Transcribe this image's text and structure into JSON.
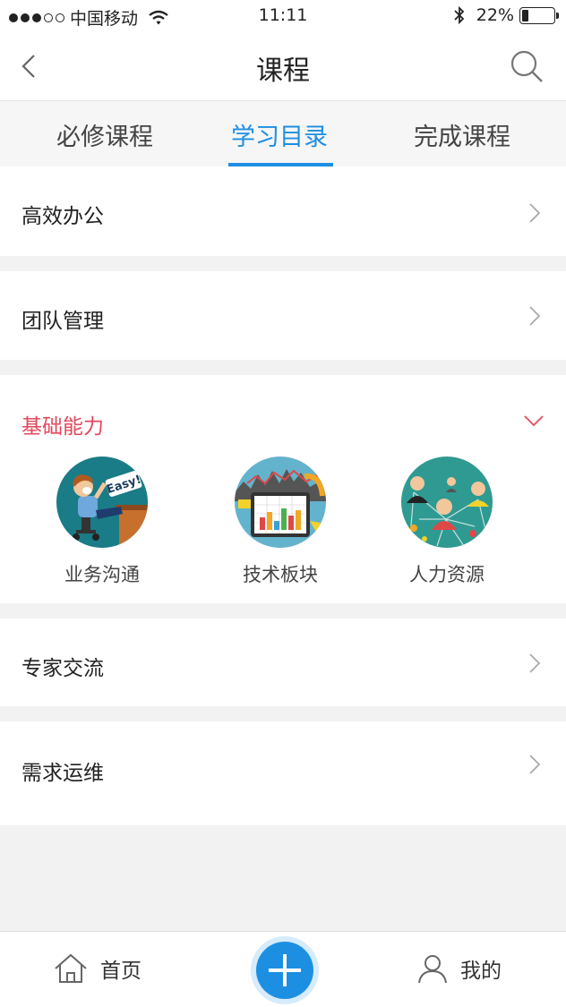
{
  "status_bar": {
    "carrier": "中国移动",
    "time": "11:11",
    "battery_text": "22%",
    "battery_level": 0.22
  },
  "nav": {
    "title": "课程"
  },
  "tabs": [
    {
      "label": "必修课程",
      "active": false
    },
    {
      "label": "学习目录",
      "active": true
    },
    {
      "label": "完成课程",
      "active": false
    }
  ],
  "catalog": [
    {
      "label": "高效办公",
      "expanded": false
    },
    {
      "label": "团队管理",
      "expanded": false
    },
    {
      "label": "基础能力",
      "expanded": true,
      "courses": [
        {
          "name": "业务沟通",
          "icon": "easy-person-illustration"
        },
        {
          "name": "技术板块",
          "icon": "bar-chart-tablet-illustration"
        },
        {
          "name": "人力资源",
          "icon": "people-network-illustration"
        }
      ]
    },
    {
      "label": "专家交流",
      "expanded": false
    },
    {
      "label": "需求运维",
      "expanded": false
    }
  ],
  "easy_badge": "Easy!",
  "tab_bar": {
    "home_label": "首页",
    "me_label": "我的"
  },
  "colors": {
    "accent": "#1c8fe3",
    "category_active": "#e5475b",
    "background": "#f2f2f2"
  }
}
